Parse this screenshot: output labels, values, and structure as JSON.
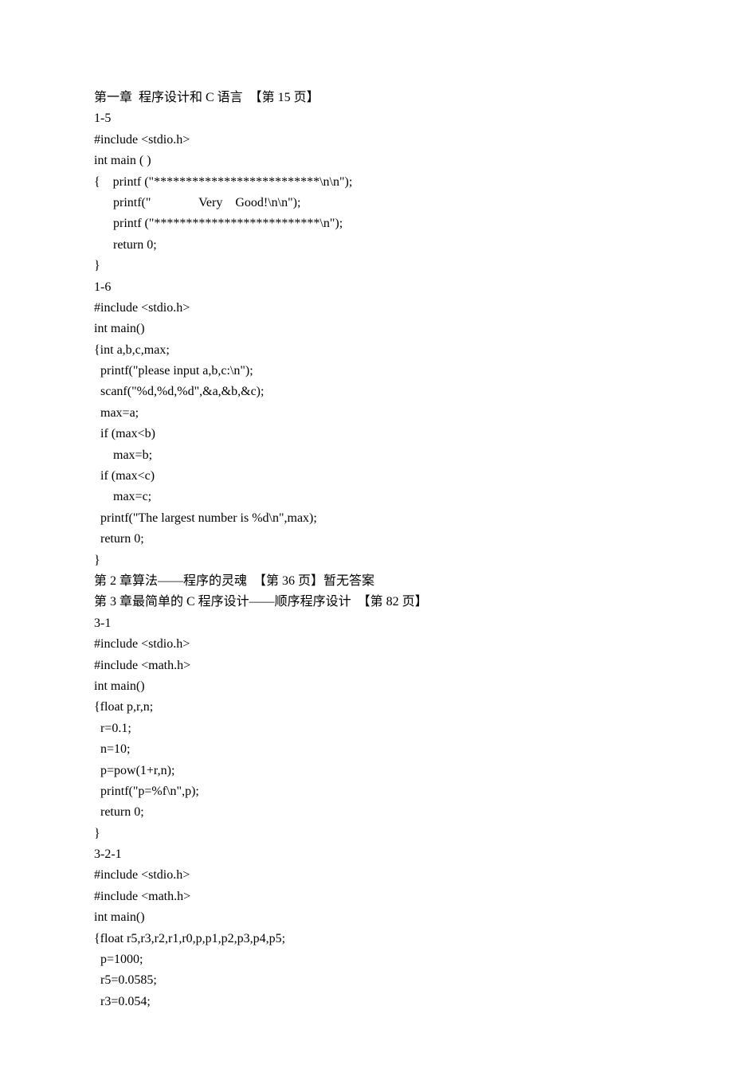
{
  "lines": [
    "第一章  程序设计和 C 语言  【第 15 页】",
    "1-5",
    "#include <stdio.h>",
    "int main ( )",
    "{    printf (\"**************************\\n\\n\");",
    "      printf(\"               Very    Good!\\n\\n\");",
    "      printf (\"**************************\\n\");",
    "      return 0;",
    "}",
    "1-6",
    "#include <stdio.h>",
    "int main()",
    "{int a,b,c,max;",
    "  printf(\"please input a,b,c:\\n\");",
    "  scanf(\"%d,%d,%d\",&a,&b,&c);",
    "  max=a;",
    "  if (max<b)",
    "      max=b;",
    "  if (max<c)",
    "      max=c;",
    "  printf(\"The largest number is %d\\n\",max);",
    "  return 0;",
    "}",
    "第 2 章算法——程序的灵魂  【第 36 页】暂无答案",
    "第 3 章最简单的 C 程序设计——顺序程序设计  【第 82 页】",
    "3-1",
    "#include <stdio.h>",
    "#include <math.h>",
    "int main()",
    "{float p,r,n;",
    "  r=0.1;",
    "  n=10;",
    "  p=pow(1+r,n);",
    "  printf(\"p=%f\\n\",p);",
    "  return 0;",
    "}",
    "3-2-1",
    "#include <stdio.h>",
    "#include <math.h>",
    "int main()",
    "{float r5,r3,r2,r1,r0,p,p1,p2,p3,p4,p5;",
    "  p=1000;",
    "  r5=0.0585;",
    "  r3=0.054;"
  ]
}
